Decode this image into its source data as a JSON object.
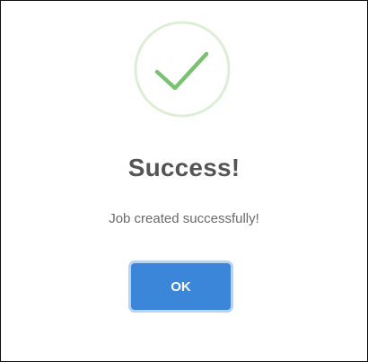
{
  "dialog": {
    "icon": "checkmark-success-icon",
    "title": "Success!",
    "message": "Job created successfully!",
    "ok_label": "OK"
  },
  "colors": {
    "icon_ring": "#dcefd6",
    "icon_check": "#79c272",
    "title_text": "#555555",
    "message_text": "#6a6a6a",
    "button_bg": "#3b86d9",
    "button_focus_ring": "#b9d3f1",
    "frame_border": "#111111"
  }
}
